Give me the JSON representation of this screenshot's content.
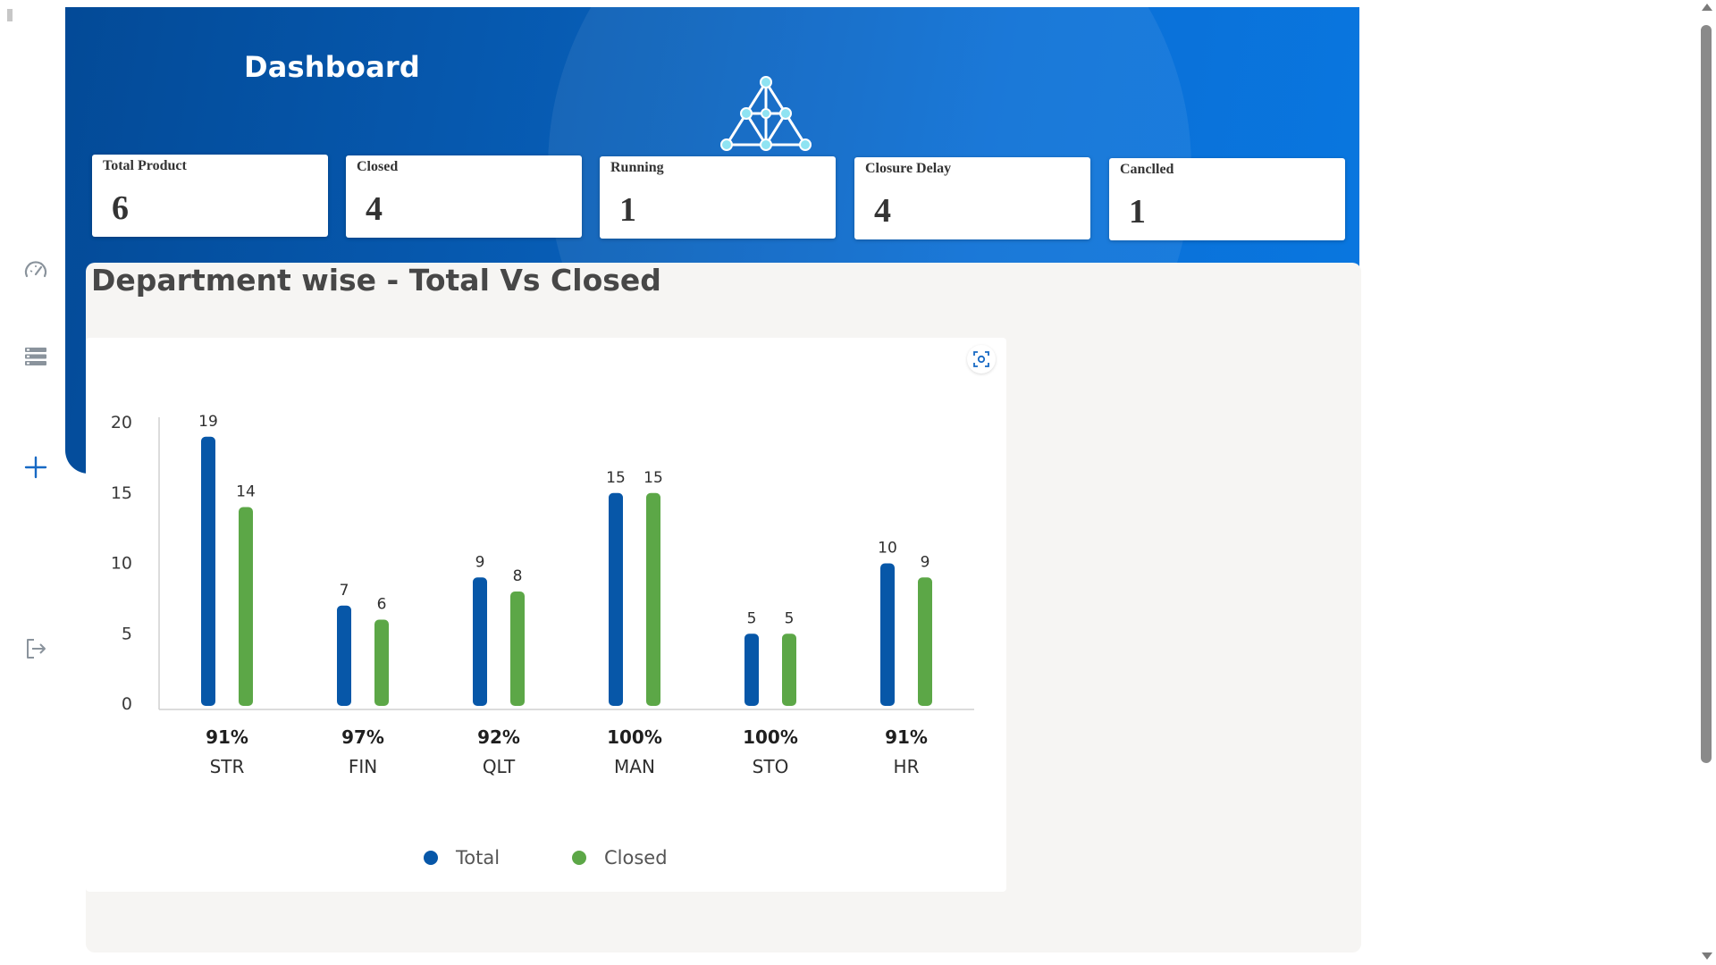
{
  "page": {
    "title": "Dashboard"
  },
  "sidebar": {
    "items": [
      {
        "icon": "speedometer-icon"
      },
      {
        "icon": "list-icon"
      },
      {
        "icon": "plus-icon"
      },
      {
        "icon": "logout-icon"
      }
    ]
  },
  "stats": [
    {
      "label": "Total Product",
      "value": "6"
    },
    {
      "label": "Closed",
      "value": "4"
    },
    {
      "label": "Running",
      "value": "1"
    },
    {
      "label": "Closure Delay",
      "value": "4"
    },
    {
      "label": "Canclled",
      "value": "1"
    }
  ],
  "section": {
    "title": "Department wise - Total Vs Closed"
  },
  "colors": {
    "total": "#0757a8",
    "closed": "#5ca747",
    "header_dark": "#034a97",
    "header_light": "#0977e0"
  },
  "chart_data": {
    "type": "bar",
    "categories": [
      "STR",
      "FIN",
      "QLT",
      "MAN",
      "STO",
      "HR"
    ],
    "category_percent": [
      "91%",
      "97%",
      "92%",
      "100%",
      "100%",
      "91%"
    ],
    "series": [
      {
        "name": "Total",
        "values": [
          19,
          7,
          9,
          15,
          5,
          10
        ]
      },
      {
        "name": "Closed",
        "values": [
          14,
          6,
          8,
          15,
          5,
          9
        ]
      }
    ],
    "ylim": [
      0,
      20
    ],
    "yticks": [
      0,
      5,
      10,
      15,
      20
    ],
    "legend_position": "bottom-center",
    "grid": false
  }
}
